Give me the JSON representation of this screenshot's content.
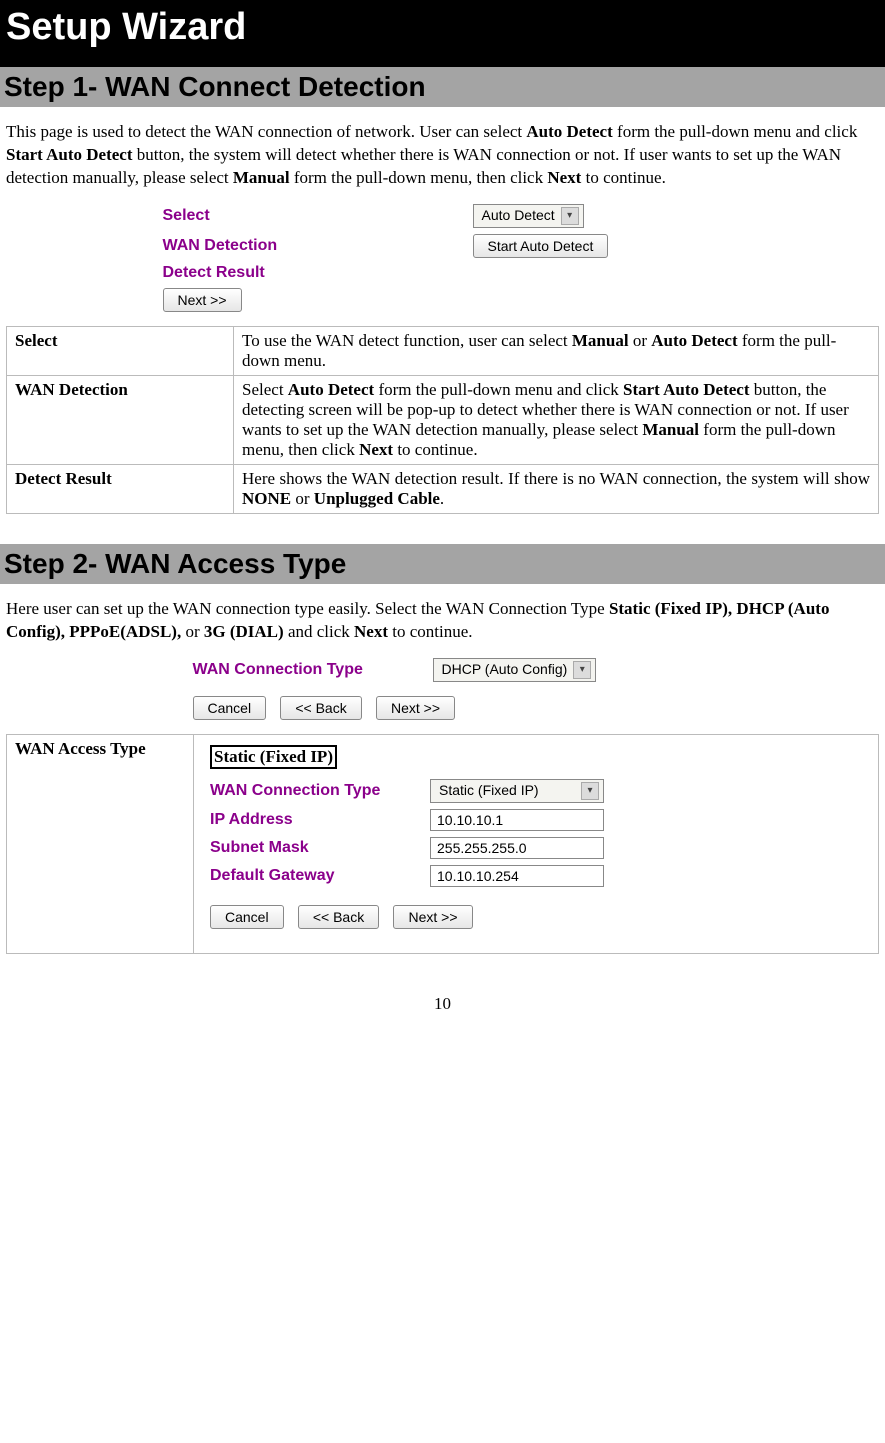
{
  "title": "Setup Wizard",
  "page_number": "10",
  "step1": {
    "heading": "Step 1- WAN Connect Detection",
    "para_parts": [
      "This page is used to detect the WAN connection of network. User can select ",
      "Auto Detect",
      "  form the pull-down menu and click ",
      "Start Auto Detect",
      " button, the system will detect whether there is WAN connection or not. If user wants to set up the WAN detection manually, please select ",
      "Manual",
      " form the pull-down menu, then click ",
      "Next",
      " to continue."
    ],
    "ui": {
      "select_label": "Select",
      "select_value": "Auto Detect",
      "detection_label": "WAN Detection",
      "detect_button": "Start Auto Detect",
      "result_label": "Detect Result",
      "next_button": "Next  >>"
    },
    "table": {
      "rows": [
        {
          "label": "Select",
          "parts": [
            "To use the WAN detect function, user can select ",
            "Manual",
            " or ",
            "Auto Detect",
            " form the pull-down menu."
          ]
        },
        {
          "label": "WAN Detection",
          "parts": [
            "Select ",
            "Auto Detect",
            " form the pull-down menu and click ",
            "Start Auto Detect",
            " button, the detecting screen will be pop-up to detect whether there is WAN connection or not. If user wants to set up the WAN detection manually, please select ",
            "Manual",
            " form the pull-down menu, then click ",
            "Next",
            " to continue."
          ]
        },
        {
          "label": "Detect Result",
          "parts": [
            "Here shows the WAN detection result. If there is no WAN connection, the system will show ",
            "NONE",
            " or ",
            "Unplugged Cable",
            "."
          ]
        }
      ]
    }
  },
  "step2": {
    "heading": "Step 2- WAN Access Type",
    "para_parts": [
      "Here user can set up the WAN connection type easily. Select the WAN Connection Type ",
      "Static (Fixed IP), DHCP (Auto Config), PPPoE(ADSL),",
      " or ",
      "3G (DIAL)",
      " and click ",
      "Next",
      " to continue."
    ],
    "ui_top": {
      "type_label": "WAN Connection Type",
      "type_value": "DHCP (Auto Config)",
      "cancel": "Cancel",
      "back": "<<  Back",
      "next": "Next  >>"
    },
    "table": {
      "label": "WAN Access Type",
      "box_label": "Static (Fixed IP)",
      "fields": {
        "type_label": "WAN Connection Type",
        "type_value": "Static (Fixed IP)",
        "ip_label": "IP Address",
        "ip_value": "10.10.10.1",
        "mask_label": "Subnet Mask",
        "mask_value": "255.255.255.0",
        "gw_label": "Default Gateway",
        "gw_value": "10.10.10.254",
        "cancel": "Cancel",
        "back": "<<  Back",
        "next": "Next  >>"
      }
    }
  }
}
